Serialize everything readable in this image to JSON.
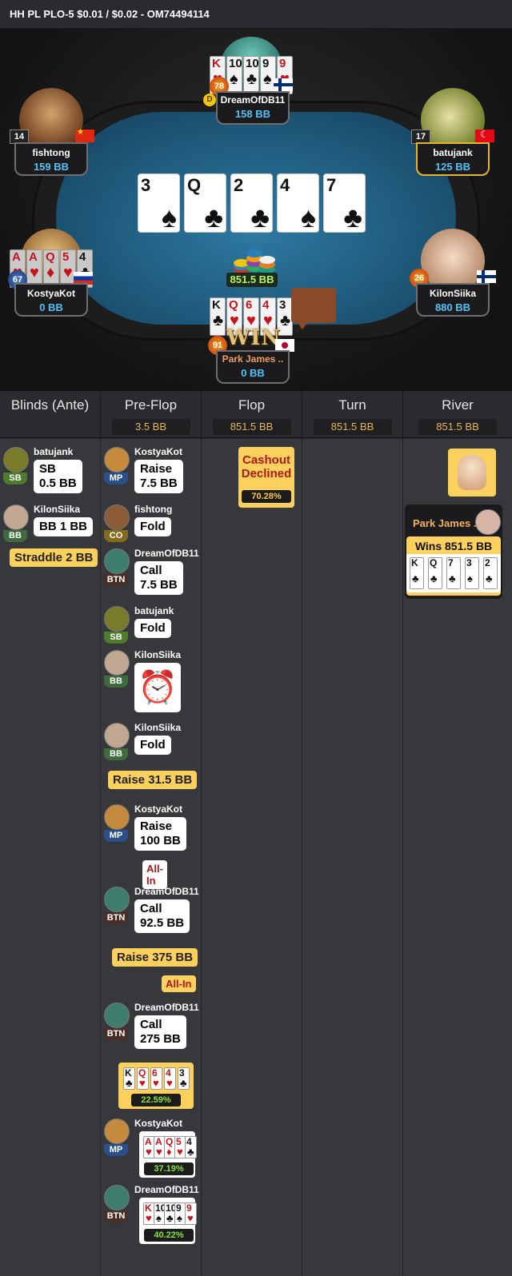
{
  "header": {
    "title": "HH PL PLO-5 $0.01 / $0.02   - OM74494114"
  },
  "table": {
    "board": [
      {
        "rank": "3",
        "suit": "♠",
        "color": "blk"
      },
      {
        "rank": "Q",
        "suit": "♣",
        "color": "blk"
      },
      {
        "rank": "2",
        "suit": "♣",
        "color": "blk"
      },
      {
        "rank": "4",
        "suit": "♠",
        "color": "blk"
      },
      {
        "rank": "7",
        "suit": "♣",
        "color": "blk"
      }
    ],
    "pot": "851.5 BB",
    "win_label": "WIN",
    "dealer_label": "D",
    "seats": [
      {
        "name": "DreamOfDB11",
        "stack": "158 BB",
        "level": "78",
        "flag": "fi",
        "cards": [
          {
            "r": "K",
            "s": "♥",
            "c": "red"
          },
          {
            "r": "10",
            "s": "♠",
            "c": "blk"
          },
          {
            "r": "10",
            "s": "♣",
            "c": "blk"
          },
          {
            "r": "9",
            "s": "♠",
            "c": "blk"
          },
          {
            "r": "9",
            "s": "♥",
            "c": "red"
          }
        ]
      },
      {
        "name": "fishtong",
        "stack": "159 BB",
        "level": "14",
        "flag": "cn"
      },
      {
        "name": "batujank",
        "stack": "125 BB",
        "level": "17",
        "flag": "tr"
      },
      {
        "name": "KostyaKot",
        "stack": "0 BB",
        "level": "67",
        "flag": "ru",
        "cards": [
          {
            "r": "A",
            "s": "♥",
            "c": "red"
          },
          {
            "r": "A",
            "s": "♥",
            "c": "red"
          },
          {
            "r": "Q",
            "s": "♦",
            "c": "red"
          },
          {
            "r": "5",
            "s": "♥",
            "c": "red"
          },
          {
            "r": "4",
            "s": "♣",
            "c": "blk"
          }
        ]
      },
      {
        "name": "KilonSiika",
        "stack": "880 BB",
        "level": "26",
        "flag": "fi"
      },
      {
        "name": "Park James ..",
        "stack": "0 BB",
        "level": "91",
        "flag": "jp",
        "cards": [
          {
            "r": "K",
            "s": "♣",
            "c": "blk"
          },
          {
            "r": "Q",
            "s": "♥",
            "c": "red"
          },
          {
            "r": "6",
            "s": "♥",
            "c": "red"
          },
          {
            "r": "4",
            "s": "♥",
            "c": "red"
          },
          {
            "r": "3",
            "s": "♣",
            "c": "blk"
          }
        ]
      }
    ]
  },
  "streets": [
    {
      "name": "Blinds (Ante)",
      "pot": ""
    },
    {
      "name": "Pre-Flop",
      "pot": "3.5 BB"
    },
    {
      "name": "Flop",
      "pot": "851.5 BB"
    },
    {
      "name": "Turn",
      "pot": "851.5 BB"
    },
    {
      "name": "River",
      "pot": "851.5 BB"
    }
  ],
  "blinds": {
    "a1": {
      "name": "batujank",
      "pos": "SB",
      "line1": "SB",
      "line2": "0.5 BB"
    },
    "a2": {
      "name": "KilonSiika",
      "pos": "BB",
      "text": "BB 1 BB"
    },
    "straddle": "Straddle 2 BB"
  },
  "preflop": {
    "p1": {
      "name": "KostyaKot",
      "pos": "MP",
      "line1": "Raise",
      "line2": "7.5 BB"
    },
    "p2": {
      "name": "fishtong",
      "pos": "CO",
      "text": "Fold"
    },
    "p3": {
      "name": "DreamOfDB11",
      "pos": "BTN",
      "line1": "Call",
      "line2": "7.5 BB"
    },
    "p4": {
      "name": "batujank",
      "pos": "SB",
      "text": "Fold"
    },
    "p5": {
      "name": "KilonSiika",
      "pos": "BB",
      "timer": "⏰"
    },
    "p6": {
      "name": "KilonSiika",
      "pos": "BB",
      "text": "Fold"
    },
    "hero_raise": "Raise 31.5 BB",
    "p7": {
      "name": "KostyaKot",
      "pos": "MP",
      "line1": "Raise",
      "line2": "100 BB",
      "allin": "All-In"
    },
    "p8": {
      "name": "DreamOfDB11",
      "pos": "BTN",
      "line1": "Call",
      "line2": "92.5 BB"
    },
    "hero_raise2": "Raise 375 BB",
    "hero_allin": "All-In",
    "p9": {
      "name": "DreamOfDB11",
      "pos": "BTN",
      "line1": "Call",
      "line2": "275 BB"
    },
    "hero_hand": {
      "cards": [
        {
          "r": "K",
          "s": "♣",
          "c": "blk"
        },
        {
          "r": "Q",
          "s": "♥",
          "c": "red"
        },
        {
          "r": "6",
          "s": "♥",
          "c": "red"
        },
        {
          "r": "4",
          "s": "♥",
          "c": "red"
        },
        {
          "r": "3",
          "s": "♣",
          "c": "blk"
        }
      ],
      "equity": "22.59%"
    },
    "p10": {
      "name": "KostyaKot",
      "pos": "MP",
      "cards": [
        {
          "r": "A",
          "s": "♥",
          "c": "red"
        },
        {
          "r": "A",
          "s": "♥",
          "c": "red"
        },
        {
          "r": "Q",
          "s": "♦",
          "c": "red"
        },
        {
          "r": "5",
          "s": "♥",
          "c": "red"
        },
        {
          "r": "4",
          "s": "♣",
          "c": "blk"
        }
      ],
      "equity": "37.19%"
    },
    "p11": {
      "name": "DreamOfDB11",
      "pos": "BTN",
      "cards": [
        {
          "r": "K",
          "s": "♥",
          "c": "red"
        },
        {
          "r": "10",
          "s": "♠",
          "c": "blk"
        },
        {
          "r": "10",
          "s": "♣",
          "c": "blk"
        },
        {
          "r": "9",
          "s": "♠",
          "c": "blk"
        },
        {
          "r": "9",
          "s": "♥",
          "c": "red"
        }
      ],
      "equity": "40.22%"
    }
  },
  "flop": {
    "cashout_line1": "Cashout",
    "cashout_line2": "Declined",
    "cashout_equity": "70.28%"
  },
  "river": {
    "winner_name": "Park James ..",
    "win_text": "Wins 851.5 BB",
    "cards": [
      {
        "r": "K",
        "s": "♣",
        "c": "blk"
      },
      {
        "r": "Q",
        "s": "♣",
        "c": "blk"
      },
      {
        "r": "7",
        "s": "♣",
        "c": "blk"
      },
      {
        "r": "3",
        "s": "♠",
        "c": "blk"
      },
      {
        "r": "2",
        "s": "♣",
        "c": "blk"
      }
    ]
  },
  "colors": {
    "accent": "#fcd05d",
    "stack": "#4fc3f7",
    "pot": "#b7f55a",
    "equity": "#8ce23a"
  }
}
